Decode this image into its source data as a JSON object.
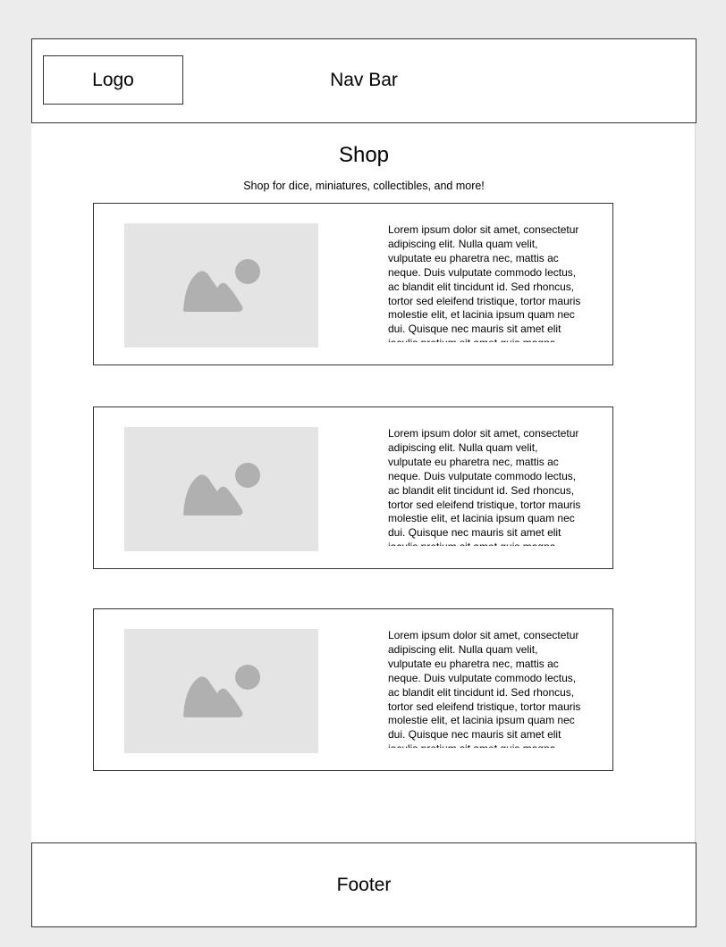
{
  "header": {
    "logo_label": "Logo",
    "nav_label": "Nav Bar"
  },
  "main": {
    "title": "Shop",
    "subtitle": "Shop for dice, miniatures, collectibles, and more!",
    "products": [
      {
        "image_icon": "image-placeholder-icon",
        "description": "Lorem ipsum dolor sit amet, consectetur adipiscing elit. Nulla quam velit, vulputate eu pharetra nec, mattis ac neque. Duis vulputate commodo lectus, ac blandit elit tincidunt id. Sed rhoncus, tortor sed eleifend tristique, tortor mauris molestie elit, et lacinia ipsum quam nec dui. Quisque nec mauris sit amet elit iaculis pretium sit amet quis magna."
      },
      {
        "image_icon": "image-placeholder-icon",
        "description": "Lorem ipsum dolor sit amet, consectetur adipiscing elit. Nulla quam velit, vulputate eu pharetra nec, mattis ac neque. Duis vulputate commodo lectus, ac blandit elit tincidunt id. Sed rhoncus, tortor sed eleifend tristique, tortor mauris molestie elit, et lacinia ipsum quam nec dui. Quisque nec mauris sit amet elit iaculis pretium sit amet quis magna."
      },
      {
        "image_icon": "image-placeholder-icon",
        "description": "Lorem ipsum dolor sit amet, consectetur adipiscing elit. Nulla quam velit, vulputate eu pharetra nec, mattis ac neque. Duis vulputate commodo lectus, ac blandit elit tincidunt id. Sed rhoncus, tortor sed eleifend tristique, tortor mauris molestie elit, et lacinia ipsum quam nec dui. Quisque nec mauris sit amet elit iaculis pretium sit amet quis magna."
      }
    ]
  },
  "footer": {
    "label": "Footer"
  },
  "colors": {
    "background": "#ececec",
    "page": "#ffffff",
    "border": "#333333",
    "image_placeholder": "#e4e4e4",
    "image_glyph": "#b0b0b0"
  }
}
